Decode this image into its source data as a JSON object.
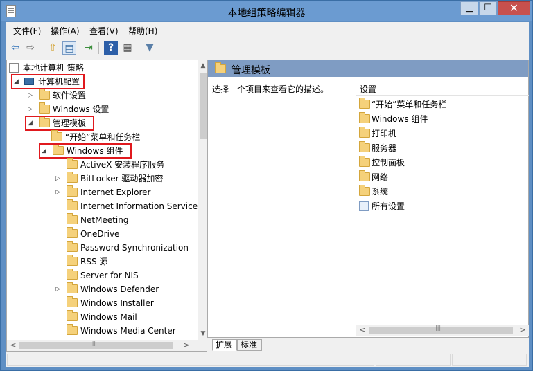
{
  "window": {
    "title": "本地组策略编辑器",
    "controls": {
      "minimize": "▁",
      "maximize": "☐",
      "close": "✕"
    }
  },
  "menu": {
    "file": "文件(F)",
    "action": "操作(A)",
    "view": "查看(V)",
    "help": "帮助(H)"
  },
  "toolbar": {
    "back": "⇦",
    "forward": "⇨",
    "up": "⇧",
    "show_hide": "▤",
    "export": "⇥",
    "help": "?",
    "properties": "▦",
    "filter": "▼"
  },
  "tree": {
    "root": "本地计算机 策略",
    "computer_config": "计算机配置",
    "software_settings": "软件设置",
    "windows_settings": "Windows 设置",
    "admin_templates": "管理模板",
    "start_menu": "“开始”菜单和任务栏",
    "windows_components": "Windows 组件",
    "children": [
      {
        "label": "ActiveX 安装程序服务",
        "expandable": false
      },
      {
        "label": "BitLocker 驱动器加密",
        "expandable": true
      },
      {
        "label": "Internet Explorer",
        "expandable": true
      },
      {
        "label": "Internet Information Services",
        "expandable": false
      },
      {
        "label": "NetMeeting",
        "expandable": false
      },
      {
        "label": "OneDrive",
        "expandable": false
      },
      {
        "label": "Password Synchronization",
        "expandable": false
      },
      {
        "label": "RSS 源",
        "expandable": false
      },
      {
        "label": "Server for NIS",
        "expandable": false
      },
      {
        "label": "Windows Defender",
        "expandable": true
      },
      {
        "label": "Windows Installer",
        "expandable": false
      },
      {
        "label": "Windows Mail",
        "expandable": false
      },
      {
        "label": "Windows Media Center",
        "expandable": false
      }
    ]
  },
  "right_pane": {
    "header": "管理模板",
    "description": "选择一个项目来查看它的描述。",
    "column_header": "设置",
    "items": [
      {
        "label": "“开始”菜单和任务栏",
        "icon": "folder-icon"
      },
      {
        "label": "Windows 组件",
        "icon": "folder-icon"
      },
      {
        "label": "打印机",
        "icon": "folder-icon"
      },
      {
        "label": "服务器",
        "icon": "folder-icon"
      },
      {
        "label": "控制面板",
        "icon": "folder-icon"
      },
      {
        "label": "网络",
        "icon": "folder-icon"
      },
      {
        "label": "系统",
        "icon": "folder-icon"
      },
      {
        "label": "所有设置",
        "icon": "settings-icon"
      }
    ]
  },
  "tabs": {
    "extended": "扩展",
    "standard": "标准"
  },
  "scroll": {
    "left_arrow": "<",
    "right_arrow": ">",
    "up_arrow": "▲",
    "down_arrow": "▼",
    "grip": "|||"
  },
  "colors": {
    "highlight_box": "#e0191e",
    "header_blue": "#7f9cc3",
    "folder_yellow": "#f5d17b"
  }
}
